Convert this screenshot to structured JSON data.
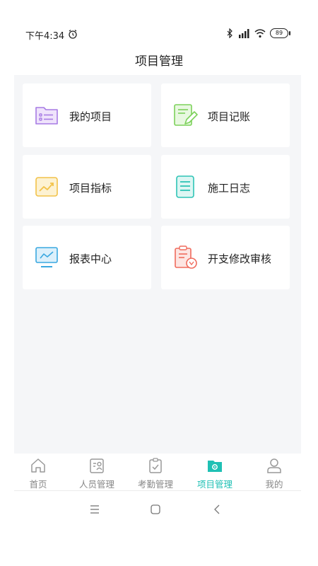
{
  "status_bar": {
    "time": "下午4:34",
    "battery": "89"
  },
  "header": {
    "title": "项目管理"
  },
  "cards": [
    {
      "label": "我的项目"
    },
    {
      "label": "项目记账"
    },
    {
      "label": "项目指标"
    },
    {
      "label": "施工日志"
    },
    {
      "label": "报表中心"
    },
    {
      "label": "开支修改审核"
    }
  ],
  "tabbar": {
    "items": [
      {
        "label": "首页",
        "icon": "home-icon"
      },
      {
        "label": "人员管理",
        "icon": "staff-icon"
      },
      {
        "label": "考勤管理",
        "icon": "attendance-icon"
      },
      {
        "label": "项目管理",
        "icon": "project-icon",
        "active": true
      },
      {
        "label": "我的",
        "icon": "profile-icon"
      }
    ],
    "active_color": "#1fc0b4",
    "inactive_color": "#888888"
  },
  "colors": {
    "my_projects": "#a77be4",
    "accounting": "#7cd15a",
    "indicators": "#f2c24a",
    "logs": "#2ec4b6",
    "reports": "#3aa8e0",
    "audit": "#f06b5d"
  }
}
